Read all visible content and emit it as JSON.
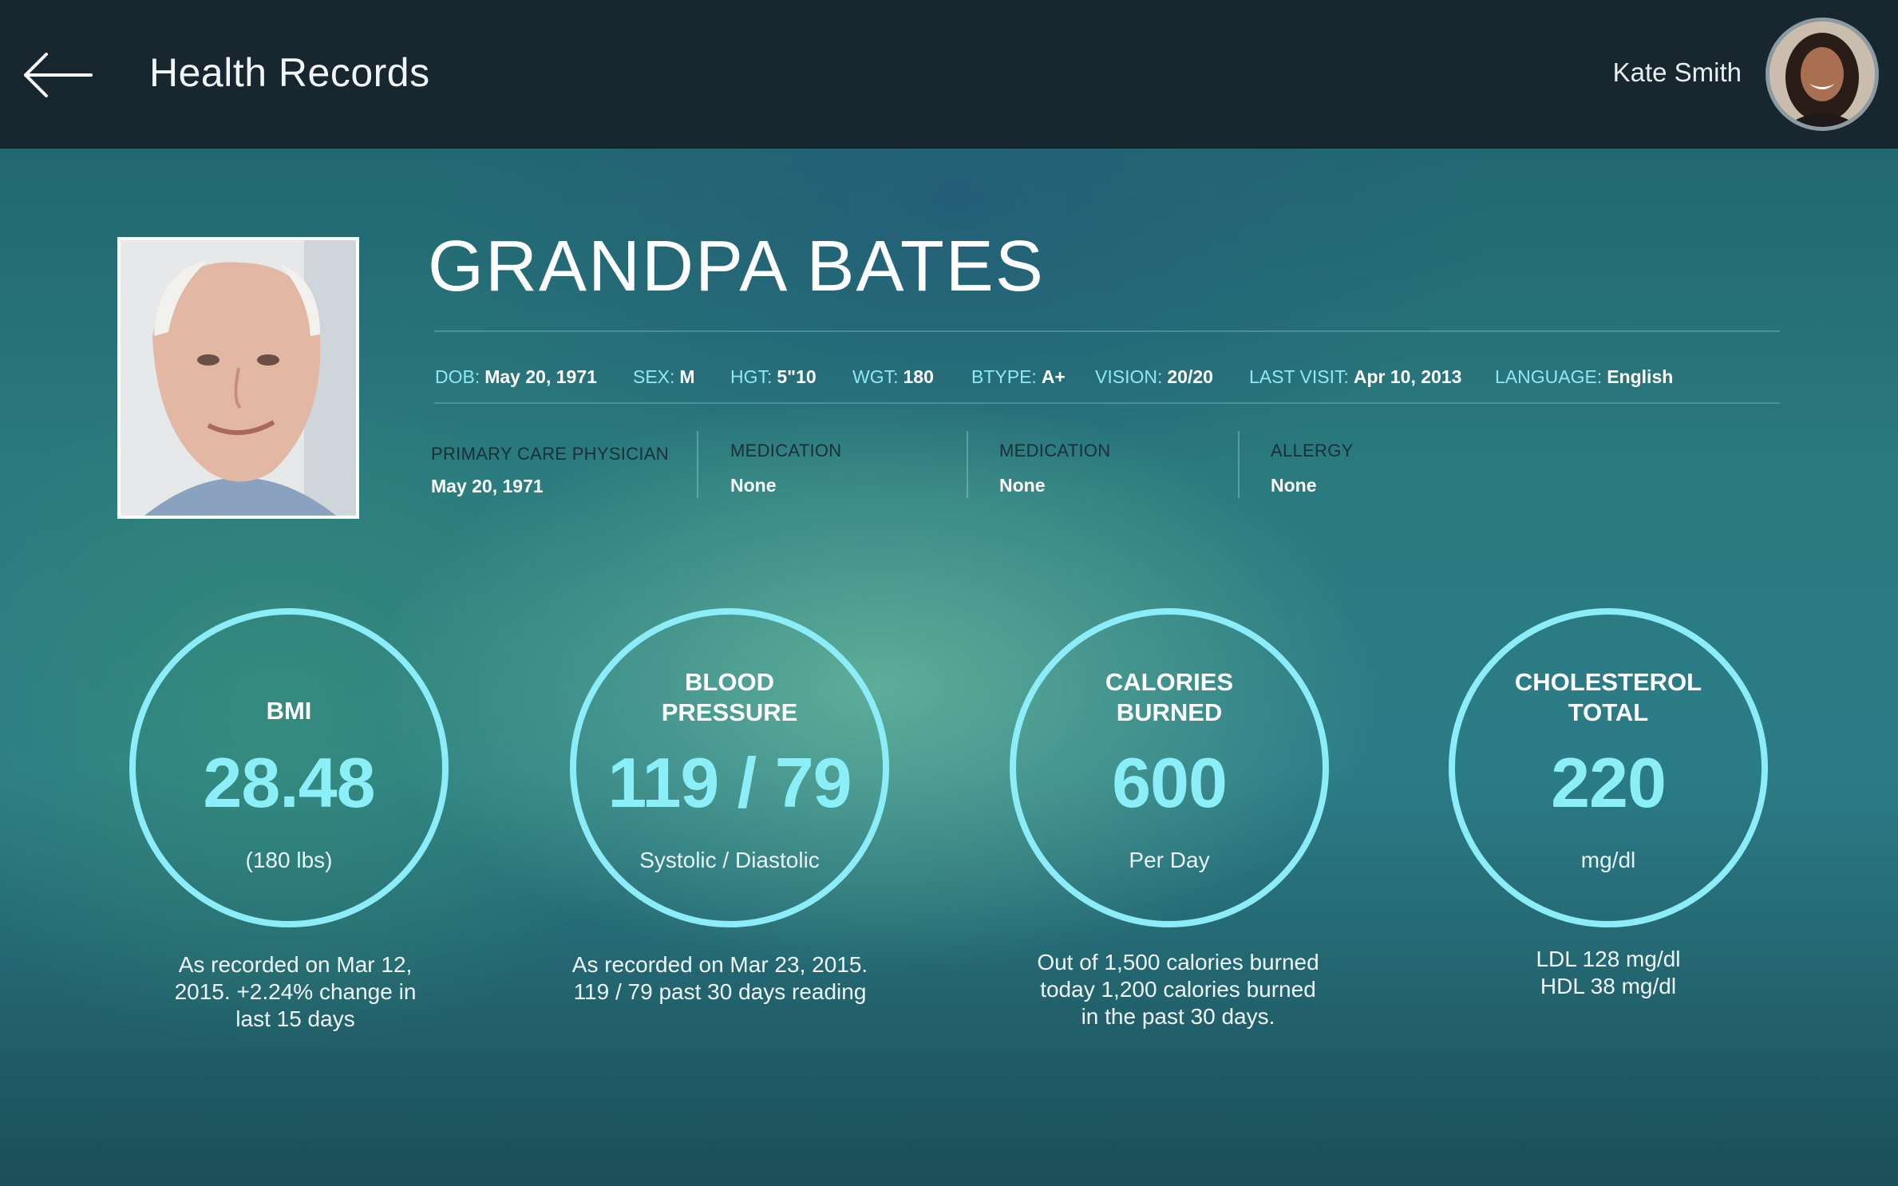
{
  "header": {
    "title": "Health Records",
    "user_name": "Kate Smith"
  },
  "patient": {
    "name": "GRANDPA BATES",
    "vitals": [
      {
        "label": "DOB:",
        "value": "May 20, 1971"
      },
      {
        "label": "SEX:",
        "value": "M"
      },
      {
        "label": "HGT:",
        "value": "5\"10"
      },
      {
        "label": "WGT:",
        "value": "180"
      },
      {
        "label": "BTYPE:",
        "value": "A+"
      },
      {
        "label": "VISION:",
        "value": "20/20"
      },
      {
        "label": "LAST VISIT:",
        "value": "Apr 10, 2013"
      },
      {
        "label": "LANGUAGE:",
        "value": "English"
      }
    ],
    "info": [
      {
        "label": "PRIMARY CARE PHYSICIAN",
        "value": "May 20, 1971"
      },
      {
        "label": "MEDICATION",
        "value": "None"
      },
      {
        "label": "MEDICATION",
        "value": "None"
      },
      {
        "label": "ALLERGY",
        "value": "None"
      }
    ]
  },
  "stats": [
    {
      "title_line1": "BMI",
      "title_line2": "",
      "value": "28.48",
      "unit": "(180 lbs)",
      "note": [
        "As recorded on Mar 12,",
        "2015. +2.24% change in",
        "last 15 days"
      ]
    },
    {
      "title_line1": "BLOOD",
      "title_line2": "PRESSURE",
      "value": "119 / 79",
      "unit": "Systolic / Diastolic",
      "note": [
        "As recorded on Mar 23, 2015.",
        "119 / 79 past 30 days reading",
        ""
      ]
    },
    {
      "title_line1": "CALORIES",
      "title_line2": "BURNED",
      "value": "600",
      "unit": "Per Day",
      "note": [
        "Out of 1,500 calories burned",
        "today 1,200 calories burned",
        "in the past 30 days."
      ]
    },
    {
      "title_line1": "CHOLESTEROL",
      "title_line2": "TOTAL",
      "value": "220",
      "unit": "mg/dl",
      "note": [
        "LDL 128 mg/dl",
        "HDL 38 mg/dl",
        ""
      ]
    }
  ],
  "icons": {
    "back": "arrow-left-icon"
  },
  "colors": {
    "header_bg": "#182630",
    "ring": "#8cecf7",
    "label_accent": "#8fe8f5"
  }
}
